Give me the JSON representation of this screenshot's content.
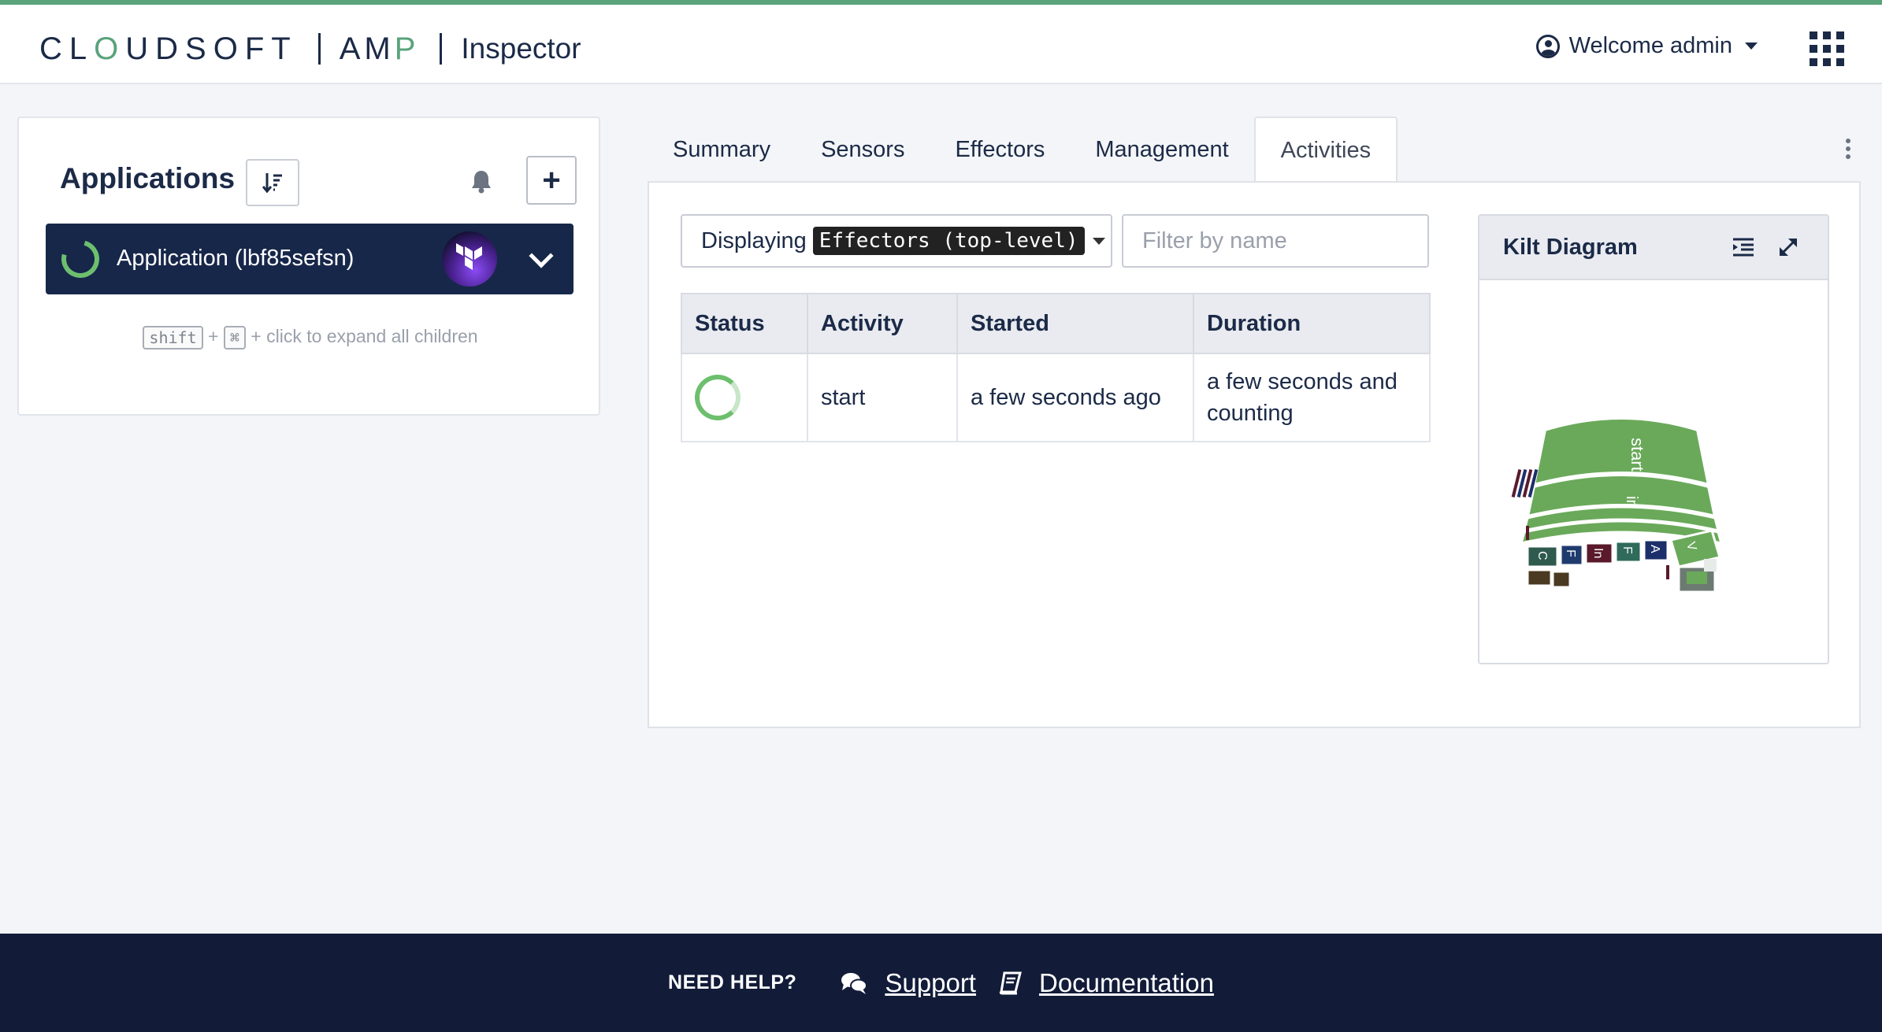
{
  "header": {
    "brand_cloudsoft_pre": "CL",
    "brand_cloudsoft_o": "O",
    "brand_cloudsoft_post": "UDSOFT",
    "brand_amp_pre": "AM",
    "brand_amp_p": "P",
    "module_title": "Inspector",
    "user_label": "Welcome admin",
    "accent_color": "#5aa37b"
  },
  "sidebar": {
    "title": "Applications",
    "add_label": "+",
    "applications": [
      {
        "name": "Application (lbf85sefsn)",
        "status": "starting",
        "icon": "terraform-logo"
      }
    ],
    "hint": {
      "key1": "shift",
      "plus": "+",
      "key2": "⌘",
      "text": "+ click to expand all children"
    }
  },
  "tabs": [
    {
      "label": "Summary",
      "active": false
    },
    {
      "label": "Sensors",
      "active": false
    },
    {
      "label": "Effectors",
      "active": false
    },
    {
      "label": "Management",
      "active": false
    },
    {
      "label": "Activities",
      "active": true
    }
  ],
  "activities": {
    "display_prefix": "Displaying",
    "display_value": "Effectors (top-level)",
    "filter_placeholder": "Filter by name",
    "columns": [
      "Status",
      "Activity",
      "Started",
      "Duration"
    ],
    "rows": [
      {
        "status": "in-progress",
        "activity": "start",
        "started": "a few seconds ago",
        "duration": "a few seconds and counting"
      }
    ]
  },
  "kilt": {
    "title": "Kilt Diagram",
    "labels": {
      "root": "start",
      "child": "in",
      "small_a": "C",
      "small_b": "F",
      "small_c": "In",
      "small_d": "F",
      "small_e": "A",
      "small_f": "V"
    }
  },
  "footer": {
    "help": "NEED HELP?",
    "support": "Support",
    "documentation": "Documentation"
  }
}
